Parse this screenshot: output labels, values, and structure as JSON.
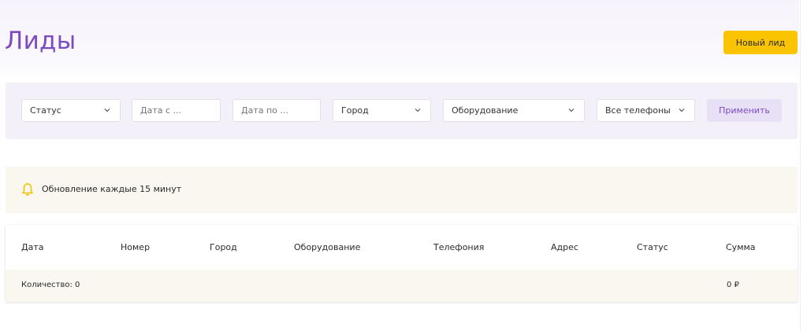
{
  "header": {
    "title": "Лиды",
    "new_lead_label": "Новый лид"
  },
  "filters": {
    "status": {
      "value": "Статус"
    },
    "date_from": {
      "placeholder": "Дата с ..."
    },
    "date_to": {
      "placeholder": "Дата по ..."
    },
    "city": {
      "value": "Город"
    },
    "equipment": {
      "value": "Оборудование"
    },
    "phones": {
      "value": "Все телефоны"
    },
    "apply_label": "Применить"
  },
  "notice": {
    "icon": "bell-icon",
    "text": "Обновление каждые 15 минут"
  },
  "table": {
    "columns": [
      "Дата",
      "Номер",
      "Город",
      "Оборудование",
      "Телефония",
      "Адрес",
      "Статус",
      "Сумма"
    ],
    "footer": {
      "count_label": "Количество: 0",
      "sum_label": "0 ₽"
    }
  },
  "colors": {
    "accent": "#7d4bc0",
    "primary_button": "#fbc400",
    "bell": "#f2c200",
    "panel": "#f3f0fa",
    "notice_bg": "#faf6f0"
  }
}
